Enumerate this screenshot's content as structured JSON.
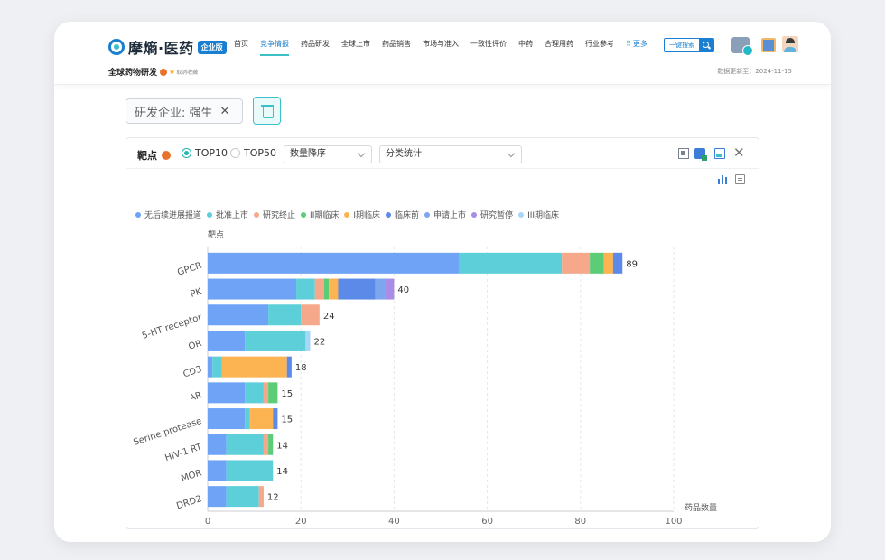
{
  "app": {
    "logo_text": "摩熵·医药",
    "edition_badge": "企业版",
    "nav": [
      {
        "label": "首页",
        "active": false
      },
      {
        "label": "竞争情报",
        "active": true
      },
      {
        "label": "药品研发",
        "active": false
      },
      {
        "label": "全球上市",
        "active": false
      },
      {
        "label": "药品销售",
        "active": false
      },
      {
        "label": "市场与准入",
        "active": false
      },
      {
        "label": "一致性评价",
        "active": false
      },
      {
        "label": "中药",
        "active": false
      },
      {
        "label": "合理用药",
        "active": false
      },
      {
        "label": "行业参考",
        "active": false
      }
    ],
    "nav_more_label": "更多",
    "search_button_label": "一键搜索",
    "icons": [
      "vip-icon",
      "message-icon",
      "avatar"
    ]
  },
  "page": {
    "title": "全球药物研发",
    "favorite_label": "取消收藏",
    "update_time": "数据更新至：2024-11-15"
  },
  "filter": {
    "tag_label": "研发企业: 强生"
  },
  "panel": {
    "title": "靶点",
    "radio_options": [
      {
        "label": "TOP10",
        "selected": true
      },
      {
        "label": "TOP50",
        "selected": false
      }
    ],
    "sort_select": "数量降序",
    "stat_select": "分类统计"
  },
  "chart_data": {
    "type": "bar",
    "orientation": "horizontal",
    "stacked": true,
    "ylabel": "靶点",
    "xlabel": "药品数量",
    "xlim": [
      0,
      100
    ],
    "x_ticks": [
      0,
      20,
      40,
      60,
      80,
      100
    ],
    "legend_position": "top",
    "categories": [
      "GPCR",
      "PK",
      "5-HT receptor",
      "OR",
      "CD3",
      "AR",
      "Serine protease",
      "HIV-1 RT",
      "MOR",
      "DRD2"
    ],
    "totals": [
      89,
      40,
      24,
      22,
      18,
      15,
      15,
      14,
      14,
      12
    ],
    "series": [
      {
        "name": "无后续进展报道",
        "color": "#6ea3f5",
        "values": [
          54,
          19,
          13,
          8,
          1,
          8,
          8,
          4,
          4,
          4
        ]
      },
      {
        "name": "批准上市",
        "color": "#5ccfd9",
        "values": [
          22,
          4,
          7,
          13,
          2,
          4,
          1,
          8,
          10,
          7
        ]
      },
      {
        "name": "研究终止",
        "color": "#f6a88a",
        "values": [
          6,
          2,
          4,
          0,
          0,
          1,
          0,
          1,
          0,
          1
        ]
      },
      {
        "name": "II期临床",
        "color": "#5ccc78",
        "values": [
          3,
          1,
          0,
          0,
          0,
          2,
          0,
          1,
          0,
          0
        ]
      },
      {
        "name": "I期临床",
        "color": "#fbb451",
        "values": [
          2,
          2,
          0,
          0,
          14,
          0,
          5,
          0,
          0,
          0
        ]
      },
      {
        "name": "临床前",
        "color": "#5b8ae8",
        "values": [
          2,
          8,
          0,
          0,
          1,
          0,
          1,
          0,
          0,
          0
        ]
      },
      {
        "name": "申请上市",
        "color": "#7da6ef",
        "values": [
          0,
          2,
          0,
          0,
          0,
          0,
          0,
          0,
          0,
          0
        ]
      },
      {
        "name": "研究暂停",
        "color": "#a88ce6",
        "values": [
          0,
          2,
          0,
          0,
          0,
          0,
          0,
          0,
          0,
          0
        ]
      },
      {
        "name": "III期临床",
        "color": "#a7d6f7",
        "values": [
          0,
          0,
          0,
          1,
          0,
          0,
          0,
          0,
          0,
          0
        ]
      }
    ]
  }
}
